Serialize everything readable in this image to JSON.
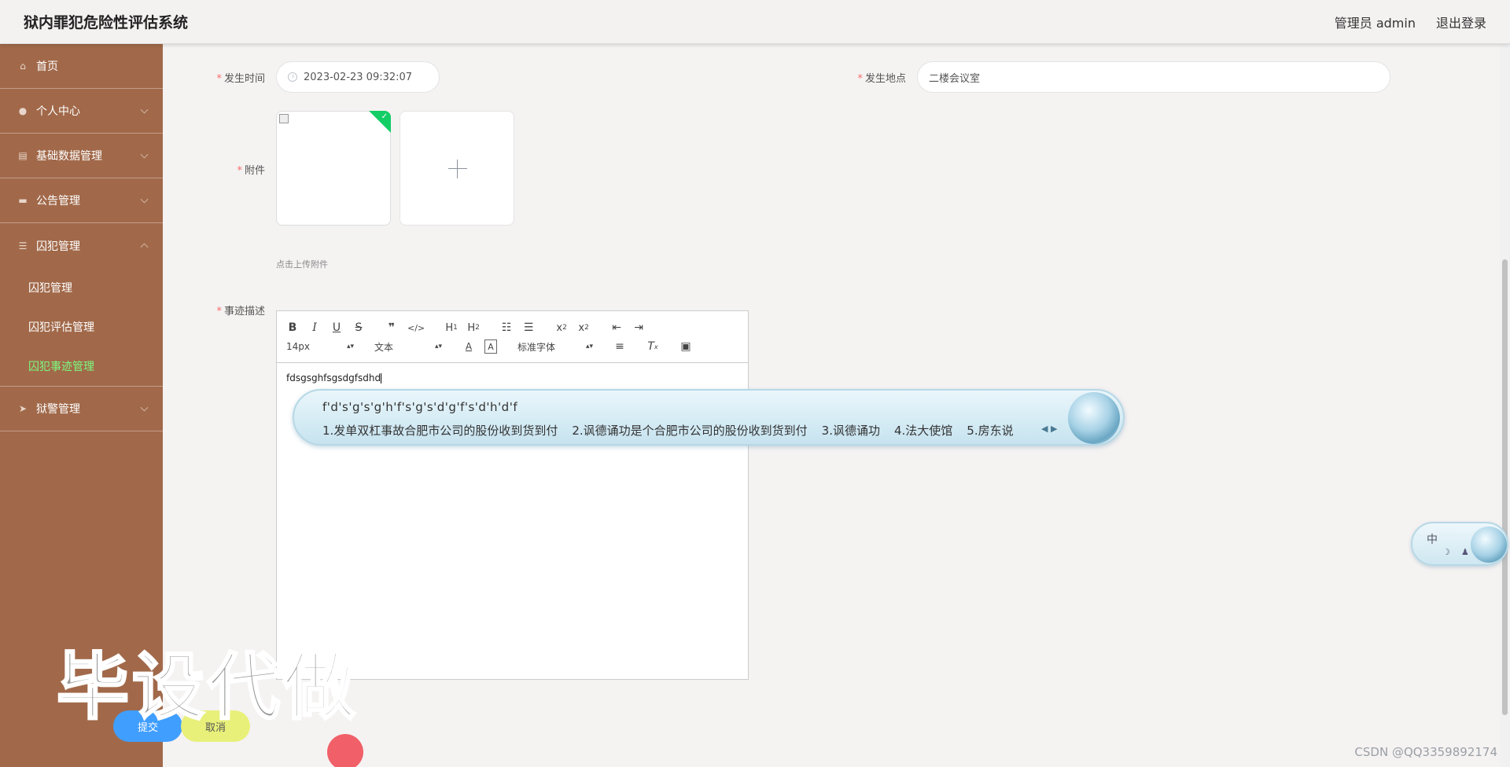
{
  "header": {
    "title": "狱内罪犯危险性评估系统",
    "user": "管理员 admin",
    "logout": "退出登录"
  },
  "sidebar": {
    "items": [
      {
        "label": "首页",
        "icon": "home-icon"
      },
      {
        "label": "个人中心",
        "icon": "user-icon"
      },
      {
        "label": "基础数据管理",
        "icon": "database-icon"
      },
      {
        "label": "公告管理",
        "icon": "chat-icon"
      },
      {
        "label": "囚犯管理",
        "icon": "list-icon"
      },
      {
        "label": "狱警管理",
        "icon": "send-icon"
      }
    ],
    "sub_items": [
      {
        "label": "囚犯管理"
      },
      {
        "label": "囚犯评估管理"
      },
      {
        "label": "囚犯事迹管理",
        "active": true
      }
    ]
  },
  "form": {
    "time_label": "发生时间",
    "time_value": "2023-02-23 09:32:07",
    "place_label": "发生地点",
    "place_value": "二楼会议室",
    "attach_label": "附件",
    "attach_hint": "点击上传附件",
    "desc_label": "事迹描述",
    "desc_value": "fdsgsghfsgsdgfsdhd"
  },
  "editor_toolbar": {
    "font_size": "14px",
    "block": "文本",
    "font_family": "标准字体"
  },
  "ime": {
    "pinyin": "f'd's'g's'g'h'f's'g's'd'g'f's'd'h'd'f",
    "candidates": [
      "1.发单双杠事故合肥市公司的股份收到货到付",
      "2.讽德诵功是个合肥市公司的股份收到货到付",
      "3.讽德诵功",
      "4.法大使馆",
      "5.房东说"
    ],
    "status": "中"
  },
  "buttons": {
    "submit": "提交",
    "cancel": "取消"
  },
  "watermark": "毕设代做",
  "csdn": "CSDN @QQ3359892174"
}
